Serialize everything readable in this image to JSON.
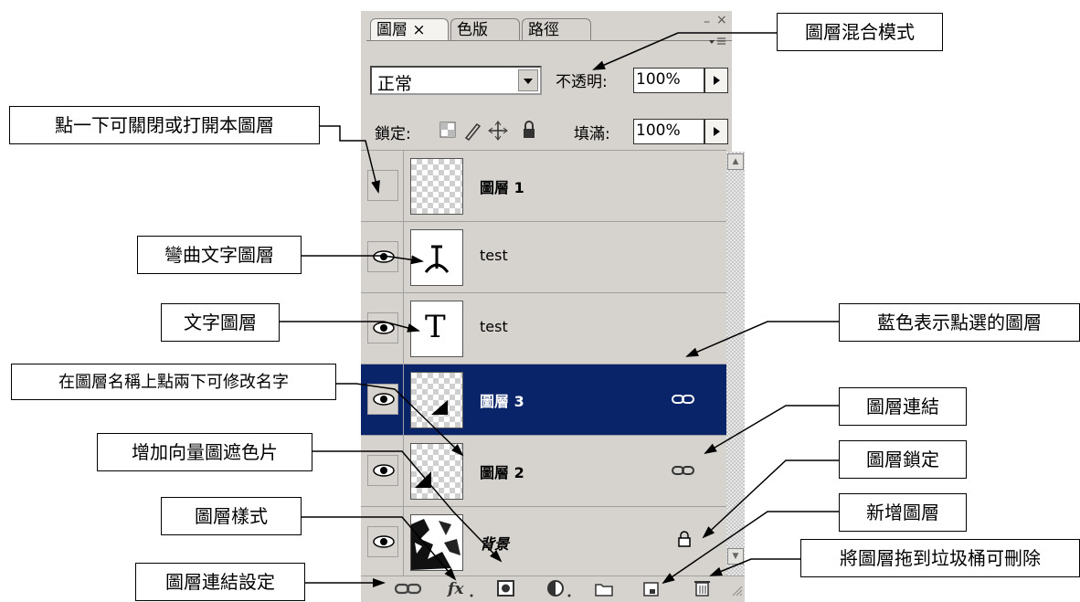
{
  "panel": {
    "tabs": [
      "圖層 ×",
      "色版",
      "路徑"
    ],
    "window_controls": [
      "–",
      "×"
    ],
    "blend_mode": "正常",
    "opacity_label": "不透明:",
    "opacity_value": "100%",
    "lock_label": "鎖定:",
    "fill_label": "填滿:",
    "fill_value": "100%"
  },
  "layers": [
    {
      "name": "圖層 1",
      "visible": false,
      "thumb": "transparent"
    },
    {
      "name": "test",
      "visible": true,
      "thumb": "warped-text"
    },
    {
      "name": "test",
      "visible": true,
      "thumb": "text",
      "thumb_glyph": "T"
    },
    {
      "name": "圖層 3",
      "visible": true,
      "thumb": "transparent",
      "selected": true,
      "linked": true
    },
    {
      "name": "圖層 2",
      "visible": true,
      "thumb": "transparent",
      "linked": true
    },
    {
      "name": "背景",
      "visible": true,
      "thumb": "photo",
      "locked": true
    }
  ],
  "callouts": {
    "blend_mode": "圖層混合模式",
    "toggle_visibility": "點一下可關閉或打開本圖層",
    "warped_text_layer": "彎曲文字圖層",
    "text_layer": "文字圖層",
    "selected_layer": "藍色表示點選的圖層",
    "rename_layer": "在圖層名稱上點兩下可修改名字",
    "vector_mask": "增加向量圖遮色片",
    "layer_link": "圖層連結",
    "layer_lock": "圖層鎖定",
    "layer_style": "圖層樣式",
    "new_layer": "新增圖層",
    "link_settings": "圖層連結設定",
    "delete_layer": "將圖層拖到垃圾桶可刪除"
  },
  "colors": {
    "panel_bg": "#d6d3ce",
    "selection": "#0a246a"
  }
}
